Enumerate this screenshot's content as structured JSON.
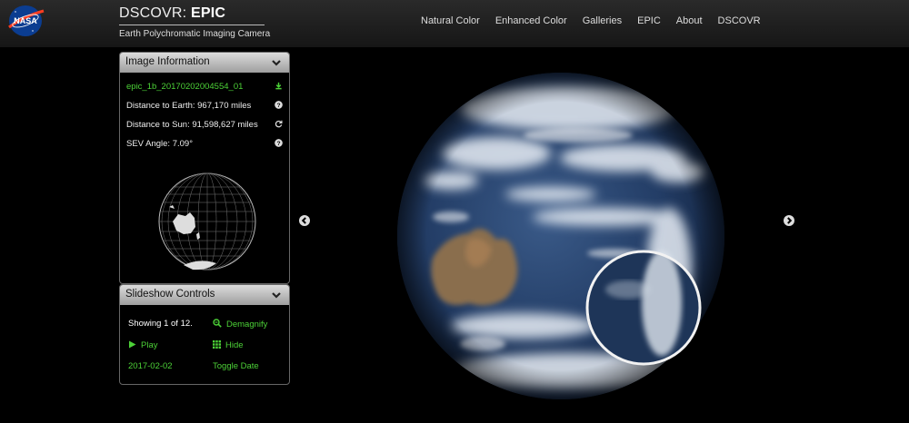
{
  "header": {
    "logo_text": "NASA",
    "title_prefix": "DSCOVR:",
    "title_main": "EPIC",
    "subtitle": "Earth Polychromatic Imaging Camera",
    "nav": [
      "Natural Color",
      "Enhanced Color",
      "Galleries",
      "EPIC",
      "About",
      "DSCOVR"
    ]
  },
  "image_info": {
    "heading": "Image Information",
    "filename": "epic_1b_20170202004554_01",
    "distance_earth": "Distance to Earth: 967,170 miles",
    "distance_sun": "Distance to Sun: 91,598,627 miles",
    "sev_angle": "SEV Angle: 7.09°",
    "icons": [
      "download-icon",
      "help-icon",
      "refresh-icon",
      "help-icon"
    ]
  },
  "slideshow": {
    "heading": "Slideshow Controls",
    "showing": "Showing 1 of 12.",
    "demagnify": "Demagnify",
    "play": "Play",
    "hide": "Hide",
    "date": "2017-02-02",
    "toggle_date": "Toggle Date"
  },
  "colors": {
    "accent_green": "#4cd137",
    "header_bg": "#1c1c1c",
    "panel_head": "#c4c4c4"
  }
}
